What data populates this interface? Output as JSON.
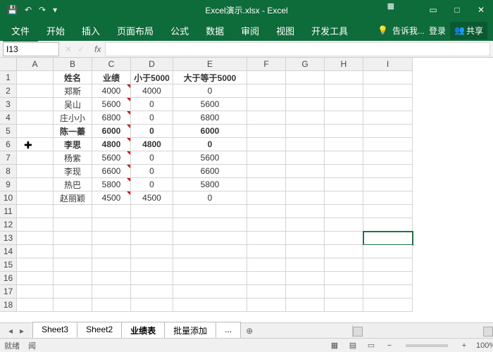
{
  "title": "Excel演示.xlsx - Excel",
  "qat": {
    "undo": "↶",
    "redo": "↷",
    "save": "💾"
  },
  "ribbon": {
    "file": "文件",
    "home": "开始",
    "insert": "插入",
    "layout": "页面布局",
    "formula": "公式",
    "data": "数据",
    "review": "审阅",
    "view": "视图",
    "dev": "开发工具",
    "tell": "告诉我...",
    "login": "登录",
    "share": "共享"
  },
  "namebox": "I13",
  "fx": {
    "cancel": "✕",
    "commit": "✓",
    "fx": "fx"
  },
  "cols": [
    "A",
    "B",
    "C",
    "D",
    "E",
    "F",
    "G",
    "H",
    "I"
  ],
  "rownums": [
    "1",
    "2",
    "3",
    "4",
    "5",
    "6",
    "7",
    "8",
    "9",
    "10",
    "11",
    "12",
    "13",
    "14",
    "15",
    "16",
    "17",
    "18"
  ],
  "headers": {
    "name": "姓名",
    "perf": "业绩",
    "lt": "小于5000",
    "ge": "大于等于5000"
  },
  "rows": [
    {
      "b": "郑斯",
      "c": "4000",
      "d": "4000",
      "e": "0",
      "hl": false
    },
    {
      "b": "吴山",
      "c": "5600",
      "d": "0",
      "e": "5600",
      "hl": false
    },
    {
      "b": "庄小小",
      "c": "6800",
      "d": "0",
      "e": "6800",
      "hl": false
    },
    {
      "b": "陈一蓁",
      "c": "6000",
      "d": "0",
      "e": "6000",
      "hl": true
    },
    {
      "b": "李思",
      "c": "4800",
      "d": "4800",
      "e": "0",
      "hl": true
    },
    {
      "b": "杨紫",
      "c": "5600",
      "d": "0",
      "e": "5600",
      "hl": false
    },
    {
      "b": "李现",
      "c": "6600",
      "d": "0",
      "e": "6600",
      "hl": false
    },
    {
      "b": "热巴",
      "c": "5800",
      "d": "0",
      "e": "5800",
      "hl": false
    },
    {
      "b": "赵丽颖",
      "c": "4500",
      "d": "4500",
      "e": "0",
      "hl": false
    }
  ],
  "sheets": {
    "s3": "Sheet3",
    "s2": "Sheet2",
    "act": "业绩表",
    "batch": "批量添加",
    "more": "..."
  },
  "status": {
    "ready": "就绪",
    "calc": "闻",
    "zoom": "100%",
    "minus": "−",
    "plus": "+"
  },
  "colors": {
    "brand": "#0e6b3a",
    "headerGreen": "#92d050",
    "highlight": "#ffff00",
    "hlText": "#d00000"
  }
}
